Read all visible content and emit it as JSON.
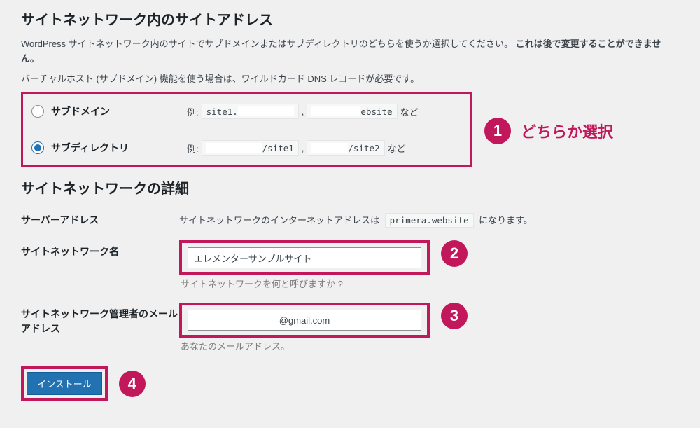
{
  "headings": {
    "address": "サイトネットワーク内のサイトアドレス",
    "details": "サイトネットワークの詳細"
  },
  "descriptions": {
    "line1_a": "WordPress サイトネットワーク内のサイトでサブドメインまたはサブディレクトリのどちらを使うか選択してください。",
    "line1_b": "これは後で変更することができません。",
    "line2": "バーチャルホスト (サブドメイン) 機能を使う場合は、ワイルドカード DNS レコードが必要です。"
  },
  "radio": {
    "subdomain_label": "サブドメイン",
    "subdirectory_label": "サブディレクトリ",
    "example_prefix": "例:",
    "subdomain_ex1_a": "site1.",
    "subdomain_ex2_b": "ebsite",
    "subdir_ex1": "/site1",
    "subdir_ex2": "/site2",
    "etc": " など"
  },
  "annotation": {
    "n1": "1",
    "n1_label": "どちらか選択",
    "n2": "2",
    "n3": "3",
    "n4": "4"
  },
  "details": {
    "server_label": "サーバーアドレス",
    "server_text_a": "サイトネットワークのインターネットアドレスは",
    "server_code": "primera.website",
    "server_text_b": "になります。",
    "network_name_label": "サイトネットワーク名",
    "network_name_value": "エレメンターサンプルサイト",
    "network_name_helper": "サイトネットワークを何と呼びますか ?",
    "admin_email_label": "サイトネットワーク管理者のメールアドレス",
    "admin_email_value": "@gmail.com",
    "admin_email_helper": "あなたのメールアドレス。"
  },
  "button": {
    "install": "インストール"
  }
}
